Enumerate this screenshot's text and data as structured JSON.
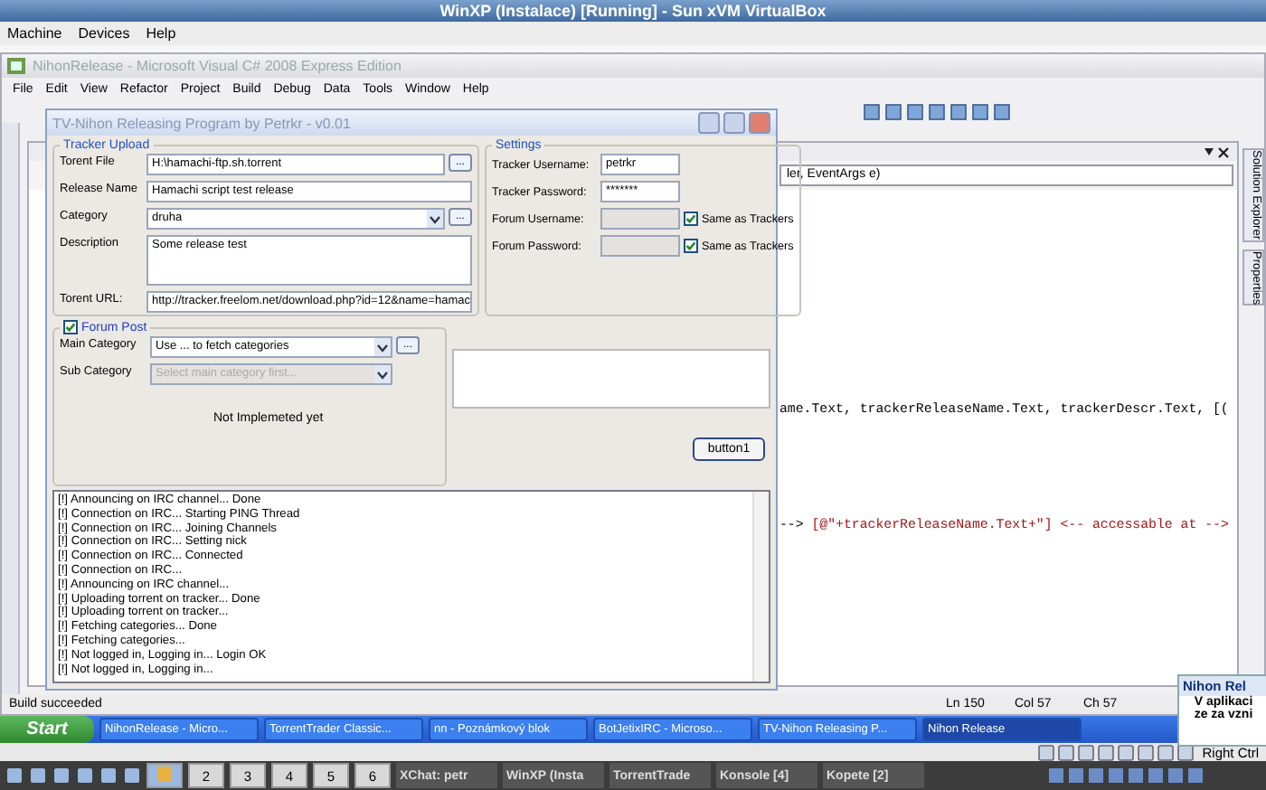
{
  "host_window": {
    "title": "WinXP (Instalace) [Running] - Sun xVM VirtualBox",
    "menu": [
      "Machine",
      "Devices",
      "Help"
    ],
    "status_key": "Right Ctrl"
  },
  "ide": {
    "title": "NihonRelease - Microsoft Visual C# 2008 Express Edition",
    "menu": [
      "File",
      "Edit",
      "View",
      "Refactor",
      "Project",
      "Build",
      "Debug",
      "Data",
      "Tools",
      "Window",
      "Help"
    ],
    "method_dropdown": "ler, EventArgs e)",
    "code_lines": [
      [
        {
          "kind": "plain",
          "text": "ame.Text, trackerReleaseName.Text, trackerDescr.Text, [("
        }
      ],
      [
        {
          "kind": "plain",
          "text": "--> "
        },
        {
          "kind": "string",
          "text": "[@\"+trackerReleaseName.Text+\"]"
        },
        {
          "kind": "string",
          "text": " <-- accessable at -->"
        }
      ]
    ],
    "side_tabs": [
      "Solution Explorer",
      "Properties"
    ],
    "status": {
      "message": "Build succeeded",
      "ln": "Ln 150",
      "col": "Col 57",
      "ch": "Ch 57"
    }
  },
  "dialog": {
    "title": "TV-Nihon Releasing Program by Petrkr - v0.01",
    "tracker_upload": {
      "title": "Tracker Upload",
      "fields": [
        {
          "label": "Torent File",
          "value": "H:\\hamachi-ftp.sh.torrent",
          "kind": "browse",
          "button": "..."
        },
        {
          "label": "Release Name",
          "value": "Hamachi script test release",
          "kind": "text"
        },
        {
          "label": "Category",
          "value": "druha",
          "kind": "combo",
          "button": "..."
        },
        {
          "label": "Description",
          "value": "Some release test",
          "kind": "multiline"
        },
        {
          "label": "Torent URL:",
          "value": "http://tracker.freelom.net/download.php?id=12&name=hamac",
          "kind": "text"
        }
      ]
    },
    "settings": {
      "title": "Settings",
      "fields": [
        {
          "label": "Tracker Username:",
          "value": "petrkr",
          "disabled": false
        },
        {
          "label": "Tracker Password:",
          "value": "*******",
          "disabled": false
        },
        {
          "label": "Forum Username:",
          "disabled": true,
          "same_as": {
            "label": "Same as Trackers",
            "checked": true
          }
        },
        {
          "label": "Forum Password:",
          "disabled": true,
          "same_as": {
            "label": "Same as Trackers",
            "checked": true
          }
        }
      ]
    },
    "forum_post": {
      "label": "Forum Post",
      "checked": true,
      "fields": [
        {
          "label": "Main Category",
          "value": "Use ... to fetch categories",
          "disabled": false,
          "button": "..."
        },
        {
          "label": "Sub Category",
          "value": "Select main category first...",
          "disabled": true
        }
      ],
      "note": "Not Implemeted yet"
    },
    "button": "button1",
    "log": [
      "[!] Announcing on IRC channel... Done",
      "[!] Connection on IRC... Starting PING Thread",
      "[!] Connection on IRC... Joining Channels",
      "[!] Connection on IRC... Setting nick",
      "[!] Connection on IRC... Connected",
      "[!] Connection on IRC...",
      "[!] Announcing on IRC channel...",
      "[!] Uploading torrent on tracker... Done",
      "[!] Uploading torrent on tracker...",
      "[!] Fetching categories... Done",
      "[!] Fetching categories...",
      "[!] Not logged in, Logging in... Login OK",
      "[!] Not logged in, Logging in..."
    ]
  },
  "xp_taskbar": {
    "start": "Start",
    "tasks": [
      {
        "label": "NihonRelease - Micro...",
        "selected": false
      },
      {
        "label": "TorrentTrader Classic...",
        "selected": false
      },
      {
        "label": "nn - Poznámkový blok",
        "selected": false
      },
      {
        "label": "BotJetixIRC - Microso...",
        "selected": false
      },
      {
        "label": "TV-Nihon Releasing P...",
        "selected": false
      },
      {
        "label": "Nihon Release",
        "selected": true
      }
    ]
  },
  "popup": {
    "title": "Nihon Rel",
    "lines": [
      "V aplikaci",
      "ze za vzni"
    ]
  },
  "host_taskbar": {
    "desktops": [
      "2",
      "3",
      "4",
      "5",
      "6"
    ],
    "tasks": [
      "XChat: petr",
      "WinXP (Insta",
      "TorrentTrade",
      "Konsole [4]",
      "Kopete [2]"
    ]
  }
}
